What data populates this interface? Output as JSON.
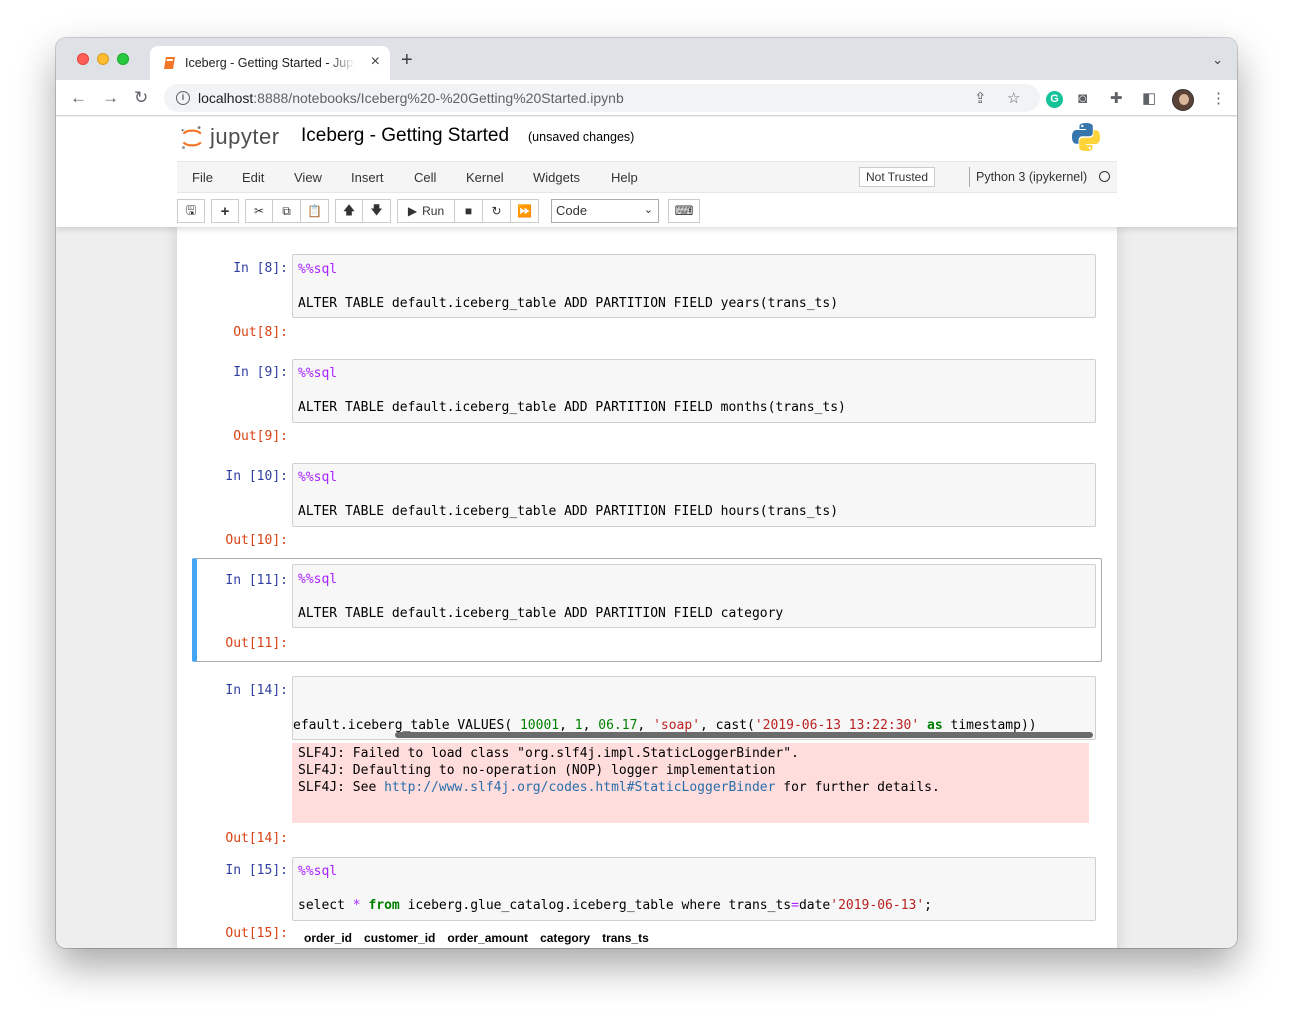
{
  "browser": {
    "tab_title": "Iceberg - Getting Started - Jupyter Notebook",
    "url_host": "localhost",
    "url_rest": ":8888/notebooks/Iceberg%20-%20Getting%20Started.ipynb"
  },
  "jupyter": {
    "logo_text": "jupyter",
    "notebook_name": "Iceberg - Getting Started",
    "save_status": "(unsaved changes)",
    "menu": [
      "File",
      "Edit",
      "View",
      "Insert",
      "Cell",
      "Kernel",
      "Widgets",
      "Help"
    ],
    "trust": "Not Trusted",
    "kernel": "Python 3 (ipykernel)",
    "run_label": "Run",
    "cell_type": "Code"
  },
  "cells": [
    {
      "in": "In [8]:",
      "out": "Out[8]:",
      "magic": "%%sql",
      "code": "ALTER TABLE default.iceberg_table ADD PARTITION FIELD years(trans_ts)"
    },
    {
      "in": "In [9]:",
      "out": "Out[9]:",
      "magic": "%%sql",
      "code": "ALTER TABLE default.iceberg_table ADD PARTITION FIELD months(trans_ts)"
    },
    {
      "in": "In [10]:",
      "out": "Out[10]:",
      "magic": "%%sql",
      "code": "ALTER TABLE default.iceberg_table ADD PARTITION FIELD hours(trans_ts)"
    },
    {
      "in": "In [11]:",
      "out": "Out[11]:",
      "magic": "%%sql",
      "code": "ALTER TABLE default.iceberg_table ADD PARTITION FIELD category"
    },
    {
      "in": "In [14]:",
      "out": "Out[14]:",
      "code_parts": {
        "p1": "efault.iceberg_table VALUES( ",
        "n1": "10001",
        "p2": ", ",
        "n2": "1",
        "p3": ", ",
        "n3": "06.17",
        "p4": ", ",
        "s1": "'soap'",
        "p5": ", cast(",
        "s2": "'2019-06-13 13:22:30'",
        "p6": " ",
        "k1": "as",
        "p7": " timestamp))"
      },
      "stderr": [
        "SLF4J: Failed to load class \"org.slf4j.impl.StaticLoggerBinder\".",
        "SLF4J: Defaulting to no-operation (NOP) logger implementation"
      ],
      "stderr_see": "SLF4J: See ",
      "stderr_link": "http://www.slf4j.org/codes.html#StaticLoggerBinder",
      "stderr_after": " for further details."
    },
    {
      "in": "In [15]:",
      "out": "Out[15]:",
      "magic": "%%sql",
      "code_parts": {
        "p1": "select ",
        "o1": "*",
        "p2": " ",
        "k1": "from",
        "p3": " iceberg.glue_catalog.iceberg_table where trans_ts",
        "o2": "=",
        "p4": "date",
        "s1": "'2019-06-13'",
        "p5": ";"
      },
      "columns": [
        "order_id",
        "customer_id",
        "order_amount",
        "category",
        "trans_ts"
      ]
    }
  ],
  "colors": {
    "selected_bar": "#42a5f5",
    "in_prompt": "#303f9f",
    "out_prompt": "#d84315",
    "stderr_bg": "#ffdddd"
  }
}
